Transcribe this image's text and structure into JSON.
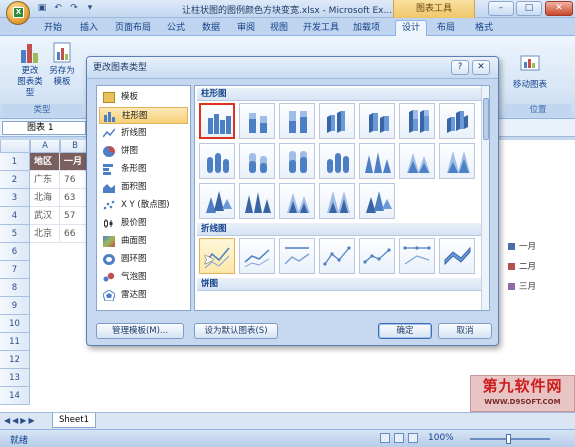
{
  "window": {
    "title": "让柱状图的图例颜色方块变宽.xlsx - Microsoft Ex...",
    "context_label": "图表工具",
    "min_label": "–",
    "max_label": "□",
    "close_label": "✕"
  },
  "office_logo": "X",
  "tabs": [
    "开始",
    "插入",
    "页面布局",
    "公式",
    "数据",
    "审阅",
    "视图",
    "开发工具",
    "加载项",
    "设计",
    "布局",
    "格式"
  ],
  "active_tab": "设计",
  "ribbon": {
    "change_type_label": "更改\n图表类型",
    "save_template_label": "另存为\n模板",
    "move_chart_label": "移动图表",
    "group_type_label": "类型",
    "group_location_label": "位置"
  },
  "formula_bar": {
    "name_box": "图表 1"
  },
  "sheet": {
    "columns": [
      "A",
      "B"
    ],
    "rows": [
      "1",
      "2",
      "3",
      "4",
      "5",
      "6",
      "7",
      "8",
      "9",
      "10",
      "11",
      "12",
      "13",
      "14"
    ],
    "header_cells": [
      "地区",
      "一月"
    ],
    "data": [
      [
        "广东",
        "76"
      ],
      [
        "北海",
        "63"
      ],
      [
        "武汉",
        "57"
      ],
      [
        "北京",
        "66"
      ]
    ]
  },
  "legend": [
    "一月",
    "二月",
    "三月"
  ],
  "legend_colors": [
    "#4a6fa5",
    "#b5504e",
    "#8f6aa8"
  ],
  "sheet_tab": "Sheet1",
  "status": {
    "ready": "就绪",
    "zoom": "100%"
  },
  "watermark": {
    "title": "第九软件网",
    "url": "WWW.D9SOFT.COM"
  },
  "dialog": {
    "title": "更改图表类型",
    "help": "?",
    "close": "✕",
    "categories": [
      {
        "label": "模板",
        "icon": "folder-icon"
      },
      {
        "label": "柱形图",
        "icon": "column-chart-icon"
      },
      {
        "label": "折线图",
        "icon": "line-chart-icon"
      },
      {
        "label": "饼图",
        "icon": "pie-chart-icon"
      },
      {
        "label": "条形图",
        "icon": "bar-chart-icon"
      },
      {
        "label": "面积图",
        "icon": "area-chart-icon"
      },
      {
        "label": "X Y (散点图)",
        "icon": "scatter-chart-icon"
      },
      {
        "label": "股价图",
        "icon": "stock-chart-icon"
      },
      {
        "label": "曲面图",
        "icon": "surface-chart-icon"
      },
      {
        "label": "圆环图",
        "icon": "doughnut-chart-icon"
      },
      {
        "label": "气泡图",
        "icon": "bubble-chart-icon"
      },
      {
        "label": "雷达图",
        "icon": "radar-chart-icon"
      }
    ],
    "selected_category": "柱形图",
    "section_column": "柱形图",
    "section_line": "折线图",
    "section_pie": "饼图",
    "manage_templates": "管理模板(M)...",
    "set_default": "设为默认图表(S)",
    "ok": "确定",
    "cancel": "取消"
  }
}
